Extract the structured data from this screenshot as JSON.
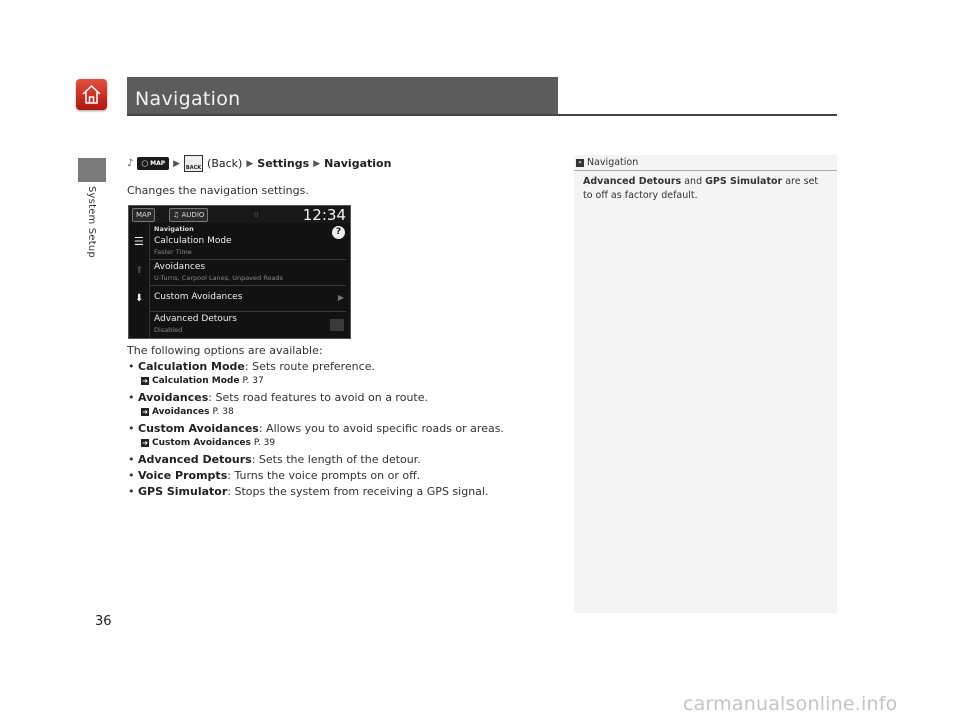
{
  "header": {
    "title": "Navigation",
    "section_tab": "System Setup",
    "page_number": "36"
  },
  "path": {
    "map_button": "MAP",
    "back_label": "(Back)",
    "back_glyph": "BACK",
    "step1": "Settings",
    "step2": "Navigation"
  },
  "intro": "Changes the navigation settings.",
  "screen": {
    "map_btn": "MAP",
    "audio_btn": "AUDIO",
    "zero": "0",
    "clock": "12:34",
    "section": "Navigation",
    "help": "?",
    "rows": [
      {
        "title": "Calculation Mode",
        "sub": "Faster Time"
      },
      {
        "title": "Avoidances",
        "sub": "U-Turns, Carpool Lanes, Unpaved Roads"
      },
      {
        "title": "Custom Avoidances",
        "sub": ""
      },
      {
        "title": "Advanced Detours",
        "sub": "Disabled"
      }
    ]
  },
  "options": {
    "heading": "The following options are available:",
    "items": [
      {
        "name": "Calculation Mode",
        "desc": ": Sets route preference.",
        "xref": "Calculation Mode",
        "page": "P. 37"
      },
      {
        "name": "Avoidances",
        "desc": ": Sets road features to avoid on a route.",
        "xref": "Avoidances",
        "page": "P. 38"
      },
      {
        "name": "Custom Avoidances",
        "desc": ": Allows you to avoid specific roads or areas.",
        "xref": "Custom Avoidances",
        "page": "P. 39"
      },
      {
        "name": "Advanced Detours",
        "desc": ": Sets the length of the detour."
      },
      {
        "name": "Voice Prompts",
        "desc": ": Turns the voice prompts on or off."
      },
      {
        "name": "GPS Simulator",
        "desc": ": Stops the system from receiving a GPS signal."
      }
    ]
  },
  "note": {
    "heading": "Navigation",
    "bold1": "Advanced Detours",
    "mid": " and ",
    "bold2": "GPS Simulator",
    "rest": " are set to off as factory default."
  },
  "watermark": "carmanualsonline.info",
  "colors": {
    "title_bar": "#5c5c5c",
    "home_icon": "#c8281c",
    "note_panel": "#f4f4f4"
  }
}
